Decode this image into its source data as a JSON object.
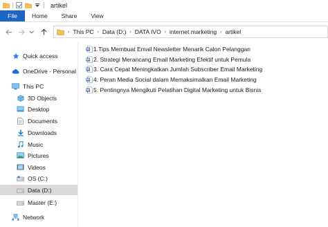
{
  "window": {
    "title": "artikel"
  },
  "ribbon": {
    "tabs": [
      "File",
      "Home",
      "Share",
      "View"
    ]
  },
  "address": {
    "crumbs": [
      "This PC",
      "Data (D:)",
      "DATA IVO",
      "internet marketing",
      "artikel"
    ]
  },
  "sidebar": {
    "items": [
      {
        "label": "Quick access",
        "icon": "star-icon"
      },
      {
        "label": "OneDrive - Personal",
        "icon": "cloud-icon"
      },
      {
        "label": "This PC",
        "icon": "computer-icon"
      },
      {
        "label": "3D Objects",
        "icon": "cube-icon"
      },
      {
        "label": "Desktop",
        "icon": "desktop-icon"
      },
      {
        "label": "Documents",
        "icon": "documents-icon"
      },
      {
        "label": "Downloads",
        "icon": "download-icon"
      },
      {
        "label": "Music",
        "icon": "music-icon"
      },
      {
        "label": "Pictures",
        "icon": "pictures-icon"
      },
      {
        "label": "Videos",
        "icon": "videos-icon"
      },
      {
        "label": "OS (C:)",
        "icon": "drive-icon"
      },
      {
        "label": "Data (D:)",
        "icon": "drive-icon",
        "selected": true
      },
      {
        "label": "Master (E:)",
        "icon": "drive-icon"
      },
      {
        "label": "Network",
        "icon": "network-icon"
      }
    ]
  },
  "files": [
    "1.Tips Membuat Email Newsletter Menarik Calon Pelanggan",
    "2. Strategi Merancang Email Marketing Efektif untuk Pemula",
    "3. Cara Cepat Meningkatkan Jumlah Subscriber Email Marketing",
    "4. Peran Media Social dalam Memaksimalkan Email Marketing",
    "5. Pentingnya Mengikuti Pelatihan Digital Marketing untuk Bisnis"
  ],
  "colors": {
    "accent": "#1c65c7",
    "folder": "#f2c14e",
    "selected_bg": "#d9d9d9",
    "word_blue": "#2b579a"
  }
}
